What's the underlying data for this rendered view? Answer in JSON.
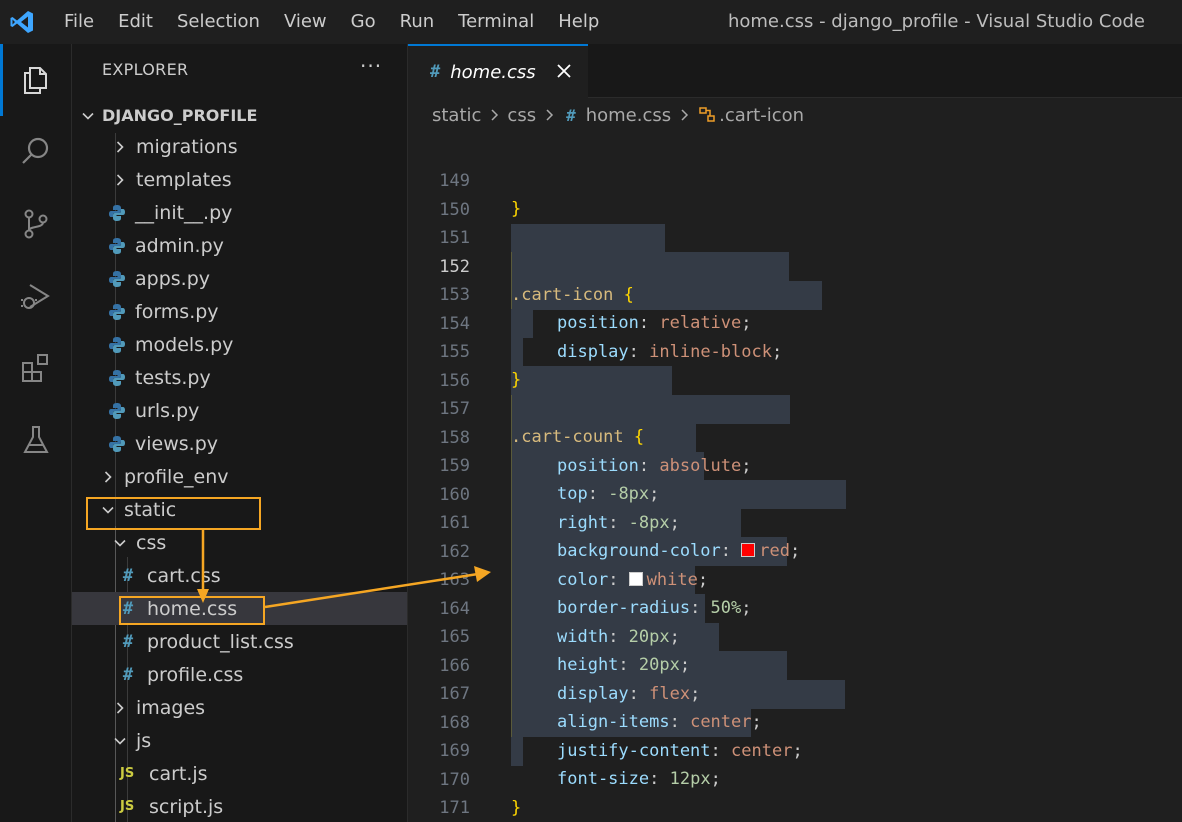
{
  "titlebar": {
    "menu": [
      "File",
      "Edit",
      "Selection",
      "View",
      "Go",
      "Run",
      "Terminal",
      "Help"
    ],
    "window_title": "home.css - django_profile - Visual Studio Code"
  },
  "activitybar": {
    "items": [
      "explorer-icon",
      "search-icon",
      "source-control-icon",
      "run-debug-icon",
      "extensions-icon",
      "testing-icon"
    ]
  },
  "sidebar": {
    "header": "EXPLORER",
    "more": "···",
    "root": "DJANGO_PROFILE",
    "tree": [
      {
        "label": "migrations",
        "kind": "folder"
      },
      {
        "label": "templates",
        "kind": "folder"
      },
      {
        "label": "__init__.py",
        "kind": "py"
      },
      {
        "label": "admin.py",
        "kind": "py"
      },
      {
        "label": "apps.py",
        "kind": "py"
      },
      {
        "label": "forms.py",
        "kind": "py"
      },
      {
        "label": "models.py",
        "kind": "py"
      },
      {
        "label": "tests.py",
        "kind": "py"
      },
      {
        "label": "urls.py",
        "kind": "py"
      },
      {
        "label": "views.py",
        "kind": "py"
      },
      {
        "label": "profile_env",
        "kind": "folder"
      },
      {
        "label": "static",
        "kind": "folder-open"
      },
      {
        "label": "css",
        "kind": "folder-open"
      },
      {
        "label": "cart.css",
        "kind": "css"
      },
      {
        "label": "home.css",
        "kind": "css",
        "selected": true
      },
      {
        "label": "product_list.css",
        "kind": "css"
      },
      {
        "label": "profile.css",
        "kind": "css"
      },
      {
        "label": "images",
        "kind": "folder"
      },
      {
        "label": "js",
        "kind": "folder-open"
      },
      {
        "label": "cart.js",
        "kind": "js"
      },
      {
        "label": "script.js",
        "kind": "js"
      }
    ]
  },
  "tabs": [
    {
      "label": "home.css",
      "icon": "#"
    }
  ],
  "breadcrumb": {
    "parts": [
      "static",
      "css",
      "home.css",
      ".cart-icon"
    ]
  },
  "editor": {
    "current_line": 152,
    "lines": [
      {
        "n": "149",
        "text": "}"
      },
      {
        "n": "150",
        "text": ""
      },
      {
        "n": "151",
        "text": ""
      },
      {
        "n": "152",
        "text": ".cart-icon {"
      },
      {
        "n": "153",
        "text": "position: relative;"
      },
      {
        "n": "154",
        "text": "display: inline-block;"
      },
      {
        "n": "155",
        "text": "}"
      },
      {
        "n": "156",
        "text": ""
      },
      {
        "n": "157",
        "text": ".cart-count {"
      },
      {
        "n": "158",
        "text": "position: absolute;"
      },
      {
        "n": "159",
        "text": "top: -8px;"
      },
      {
        "n": "160",
        "text": "right: -8px;"
      },
      {
        "n": "161",
        "text": "background-color: red;"
      },
      {
        "n": "162",
        "text": "color: white;"
      },
      {
        "n": "163",
        "text": "border-radius: 50%;"
      },
      {
        "n": "164",
        "text": "width: 20px;"
      },
      {
        "n": "165",
        "text": "height: 20px;"
      },
      {
        "n": "166",
        "text": "display: flex;"
      },
      {
        "n": "167",
        "text": "align-items: center;"
      },
      {
        "n": "168",
        "text": "justify-content: center;"
      },
      {
        "n": "169",
        "text": "font-size: 12px;"
      },
      {
        "n": "170",
        "text": "}"
      },
      {
        "n": "171",
        "text": ""
      }
    ]
  },
  "colors": {
    "accent": "#0078d4",
    "annotation": "#f5a623",
    "swatch_red": "#ff0000",
    "swatch_white": "#ffffff"
  }
}
